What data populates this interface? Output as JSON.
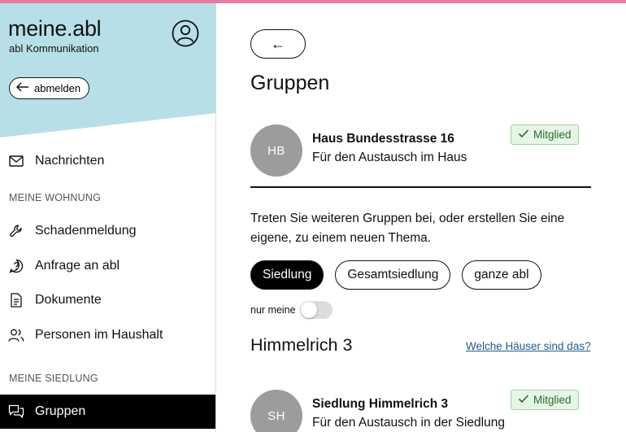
{
  "colors": {
    "accent_bar": "#e87aa6",
    "sidebar_header_bg": "#b7dfe7",
    "badge_bg": "#e6f5e6",
    "badge_text": "#2b6b2b",
    "avatar_bg": "#9c9c9c",
    "link": "#1f5a8a"
  },
  "sidebar": {
    "brand": "meine.abl",
    "brand_sub": "abl Kommunikation",
    "profile_icon": "user-circle-icon",
    "logout_label": "abmelden",
    "nav": {
      "messages": {
        "label": "Nachrichten",
        "icon": "mail-icon"
      },
      "section_wohnung": "MEINE WOHNUNG",
      "damage": {
        "label": "Schadenmeldung",
        "icon": "wrench-icon"
      },
      "inquiry": {
        "label": "Anfrage an abl",
        "icon": "question-bubble-icon"
      },
      "documents": {
        "label": "Dokumente",
        "icon": "document-icon"
      },
      "household": {
        "label": "Personen im Haushalt",
        "icon": "people-icon"
      },
      "section_siedlung": "MEINE SIEDLUNG",
      "groups": {
        "label": "Gruppen",
        "icon": "chat-bubbles-icon",
        "active": true
      }
    }
  },
  "main": {
    "back_label": "←",
    "title": "Gruppen",
    "my_group": {
      "initials": "HB",
      "name": "Haus Bundesstrasse 16",
      "description": "Für den Austausch im Haus",
      "badge": "Mitglied"
    },
    "intro": "Treten Sie weiteren Gruppen bei, oder erstellen Sie eine eigene, zu einem neuen Thema.",
    "filters": [
      {
        "label": "Siedlung",
        "active": true
      },
      {
        "label": "Gesamtsiedlung",
        "active": false
      },
      {
        "label": "ganze abl",
        "active": false
      }
    ],
    "toggle_label": "nur meine",
    "toggle_on": false,
    "section": {
      "title": "Himmelrich 3",
      "link": "Welche Häuser sind das?"
    },
    "section_group": {
      "initials": "SH",
      "name": "Siedlung Himmelrich 3",
      "description": "Für den Austausch in der Siedlung",
      "badge": "Mitglied"
    }
  }
}
